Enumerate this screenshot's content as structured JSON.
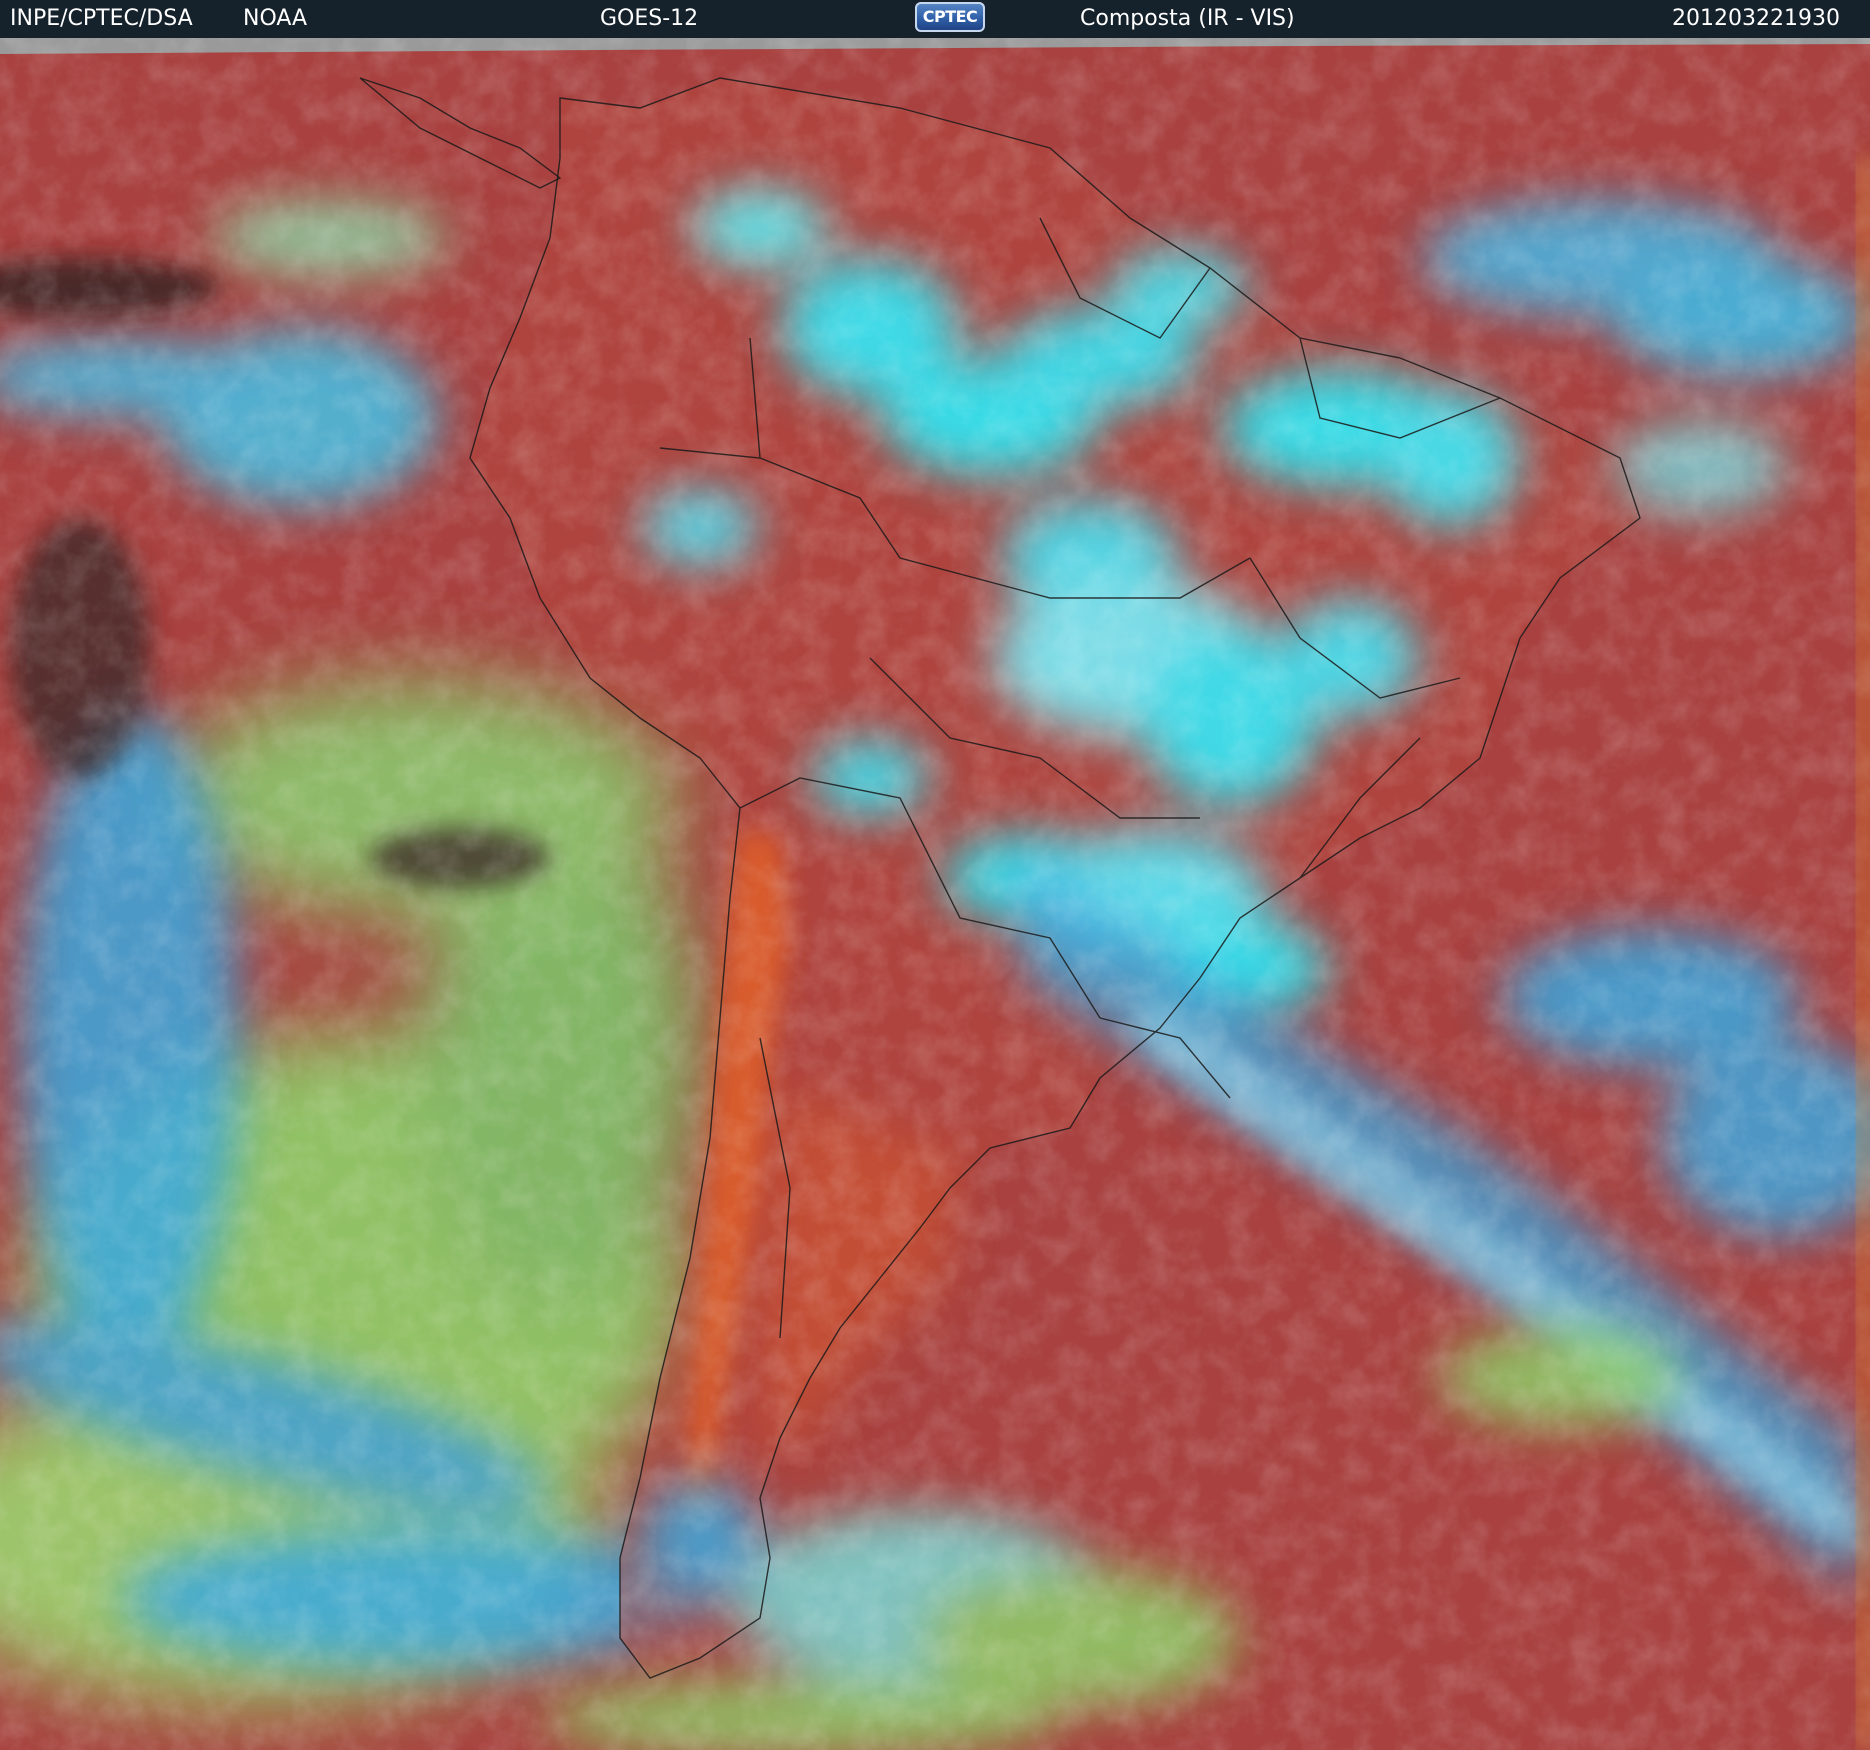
{
  "header": {
    "organization": "INPE/CPTEC/DSA",
    "agency": "NOAA",
    "satellite": "GOES-12",
    "logo_text": "CPTEC",
    "product": "Composta (IR - VIS)",
    "timestamp": "201203221930"
  },
  "colors": {
    "header_background": "#15212b",
    "clear_land_ocean": "#a8413f",
    "andes_warm_surface": "#e0602a",
    "high_cold_clouds": "#2ee8f5",
    "low_clouds": "#8fcf6a",
    "mid_clouds": "#3aa8e0",
    "boundary_lines": "#1a1a1a"
  },
  "icons": {
    "logo": "cptec-logo"
  }
}
